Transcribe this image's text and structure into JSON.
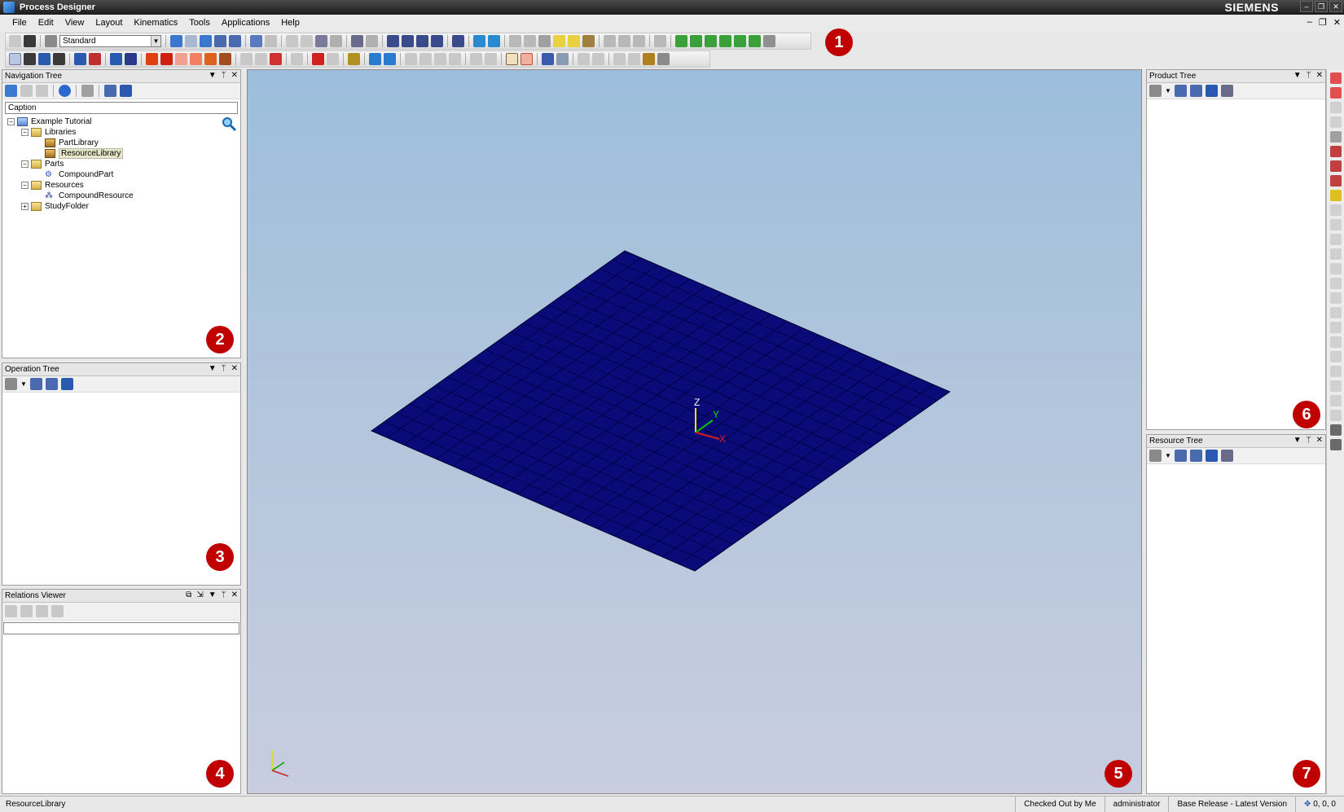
{
  "window": {
    "title": "Process Designer",
    "brand": "SIEMENS"
  },
  "menu": [
    "File",
    "Edit",
    "View",
    "Layout",
    "Kinematics",
    "Tools",
    "Applications",
    "Help"
  ],
  "toolbar": {
    "layout_combo_value": "Standard"
  },
  "navigation_tree": {
    "title": "Navigation Tree",
    "column_header": "Caption",
    "nodes": [
      {
        "label": "Example Tutorial"
      },
      {
        "label": "Libraries"
      },
      {
        "label": "PartLibrary"
      },
      {
        "label": "ResourceLibrary"
      },
      {
        "label": "Parts"
      },
      {
        "label": "CompoundPart"
      },
      {
        "label": "Resources"
      },
      {
        "label": "CompoundResource"
      },
      {
        "label": "StudyFolder"
      }
    ]
  },
  "operation_tree": {
    "title": "Operation Tree"
  },
  "relations_viewer": {
    "title": "Relations Viewer"
  },
  "product_tree": {
    "title": "Product Tree"
  },
  "resource_tree": {
    "title": "Resource Tree"
  },
  "viewport": {
    "axis_x": "X",
    "axis_y": "Y",
    "axis_z": "Z"
  },
  "badges": [
    "1",
    "2",
    "3",
    "4",
    "5",
    "6",
    "7"
  ],
  "status": {
    "selection": "ResourceLibrary",
    "checkout": "Checked Out by Me",
    "user": "administrator",
    "release": "Base Release - Latest Version",
    "coords": "0, 0, 0"
  },
  "colors": {
    "floor": "#0a0a78",
    "badge": "#c00000",
    "viewport_top": "#9cbedc",
    "viewport_bottom": "#c8cde0"
  }
}
